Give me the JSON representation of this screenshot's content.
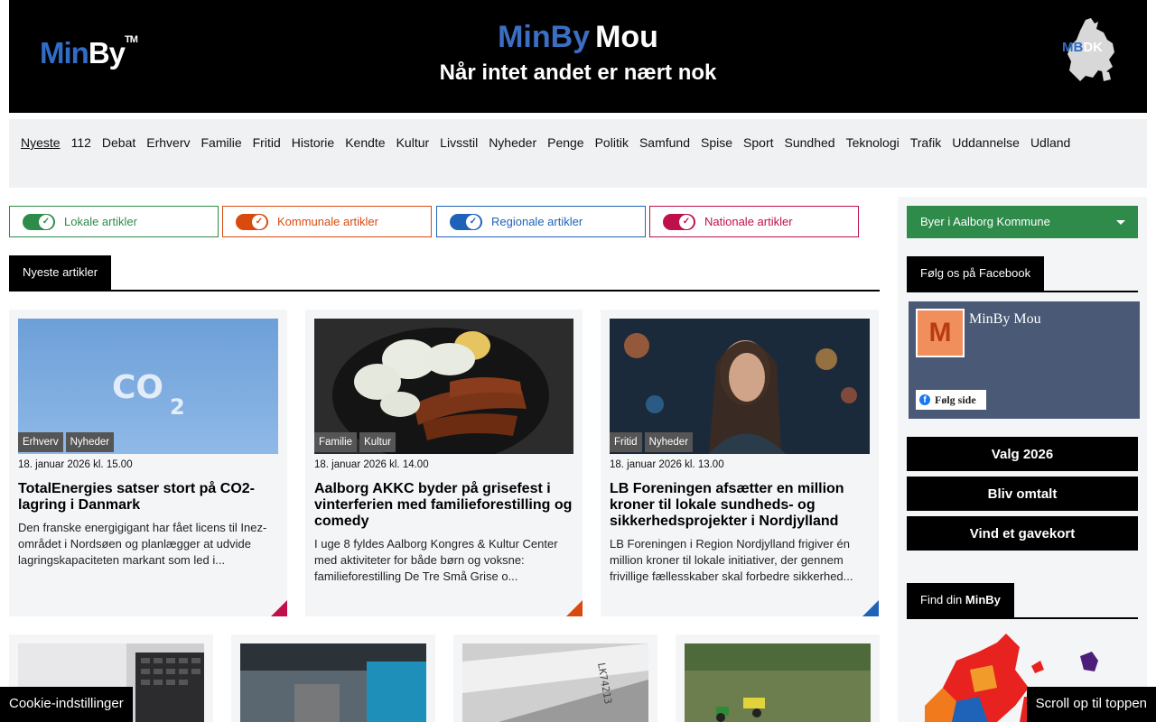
{
  "header": {
    "logo_min": "Min",
    "logo_by": "By",
    "logo_tm": "TM",
    "title_part1": "MinBy",
    "title_part2": "Mou",
    "tagline": "Når intet andet er nært nok",
    "logo_right_mb": "MB",
    "logo_right_dk": "DK"
  },
  "nav": {
    "items": [
      "Nyeste",
      "112",
      "Debat",
      "Erhverv",
      "Familie",
      "Fritid",
      "Historie",
      "Kendte",
      "Kultur",
      "Livsstil",
      "Nyheder",
      "Penge",
      "Politik",
      "Samfund",
      "Spise",
      "Sport",
      "Sundhed",
      "Teknologi",
      "Trafik",
      "Uddannelse",
      "Udland"
    ],
    "active": "Nyeste"
  },
  "filters": [
    {
      "label": "Lokale artikler",
      "color": "#2e8b4a"
    },
    {
      "label": "Kommunale artikler",
      "color": "#d94a0f"
    },
    {
      "label": "Regionale artikler",
      "color": "#1f63b8"
    },
    {
      "label": "Nationale artikler",
      "color": "#c0104a"
    }
  ],
  "section": {
    "title": "Nyeste artikler"
  },
  "articles": [
    {
      "tags": [
        "Erhverv",
        "Nyheder"
      ],
      "date": "18. januar 2026 kl. 15.00",
      "title": "TotalEnergies satser stort på CO2-lagring i Danmark",
      "excerpt": "Den franske energigigant har fået licens til Inez-området i Nordsøen og planlægger at udvide lagringskapaciteten markant som led i...",
      "corner_color": "#c0104a"
    },
    {
      "tags": [
        "Familie",
        "Kultur"
      ],
      "date": "18. januar 2026 kl. 14.00",
      "title": "Aalborg AKKC byder på grisefest i vinterferien med familieforestilling og comedy",
      "excerpt": "I uge 8 fyldes Aalborg Kongres & Kultur Center med aktiviteter for både børn og voksne: familieforestilling De Tre Små Grise o...",
      "corner_color": "#d94a0f"
    },
    {
      "tags": [
        "Fritid",
        "Nyheder"
      ],
      "date": "18. januar 2026 kl. 13.00",
      "title": "LB Foreningen afsætter en million kroner til lokale sundheds- og sikkerhedsprojekter i Nordjylland",
      "excerpt": "LB Foreningen i Region Nordjylland frigiver én million kroner til lokale initiativer, der gennem frivillige fællesskaber skal forbedre sikkerhed...",
      "corner_color": "#1f63b8"
    }
  ],
  "sidebar": {
    "dropdown": "Byer i Aalborg Kommune",
    "facebook_head": "Følg os på Facebook",
    "fb_page_name": "MinBy Mou",
    "fb_avatar_letter": "M",
    "fb_follow": "Følg side",
    "buttons": [
      "Valg 2026",
      "Bliv omtalt",
      "Vind et gavekort"
    ],
    "find_head_prefix": "Find din",
    "find_head_brand": "MinBy"
  },
  "footer": {
    "cookie": "Cookie-indstillinger",
    "scroll_top": "Scroll op til toppen"
  },
  "colors": {
    "lokal": "#2e8b4a",
    "kommunal": "#d94a0f",
    "regional": "#1f63b8",
    "national": "#c0104a"
  }
}
